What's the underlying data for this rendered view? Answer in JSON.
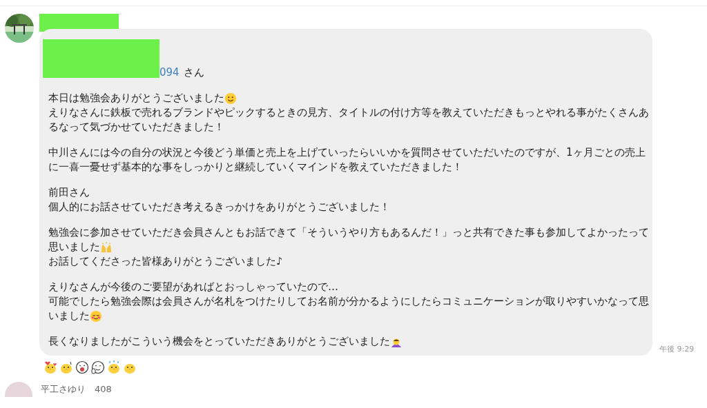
{
  "sender": {
    "name_redacted": true
  },
  "message": {
    "mention_redacted": true,
    "mention": "094",
    "mention_suffix": "さん",
    "paragraphs": [
      [
        {
          "text": "本日は勉強会ありがとうございました",
          "kind": "smile"
        },
        {
          "text": "えりなさんに鉄板で売れるブランドやピックするときの見方、タイトルの付け方等を教えていただきもっとやれる事がたくさんあ"
        },
        {
          "text": "るなって気づかせていただきました！"
        }
      ],
      [
        {
          "text": "中川さんには今の自分の状況と今後どう単価と売上を上げていったらいいかを質問させていただいたのですが、1ヶ月ごとの売上"
        },
        {
          "text": "に一喜一憂せず基本的な事をしっかりと継続していくマインドを教えていただきました！"
        }
      ],
      [
        {
          "text": "前田さん"
        },
        {
          "text": "個人的にお話させていただき考えるきっかけをありがとうございました！"
        }
      ],
      [
        {
          "text": "勉強会に参加させていただき会員さんともお話できて「そういうやり方もあるんだ！」っと共有できた事も参加してよかったって"
        },
        {
          "text": "思いました",
          "kind": "raised-hands"
        },
        {
          "text": "お話してくださった皆様ありがとうございました♪"
        }
      ],
      [
        {
          "text": "えりなさんが今後のご要望があればとおっしゃっていたので…"
        },
        {
          "text": "可能でしたら勉強会際は会員さんが名札をつけたりしてお名前が分かるようにしたらコミュニケーションが取りやすいかなって思"
        },
        {
          "text": "いました",
          "kind": "blush"
        }
      ],
      [
        {
          "text": "長くなりましたがこういう機会をとっていただきありがとうございました",
          "kind": "bow"
        }
      ]
    ],
    "time": "午後 9:29"
  },
  "reactions": [
    {
      "kind": "heart-chick"
    },
    {
      "kind": "waving-chick"
    },
    {
      "kind": "laughing-face"
    },
    {
      "kind": "thumbs-face"
    },
    {
      "kind": "sparkle-chick"
    },
    {
      "kind": "chick"
    }
  ],
  "next_sender": {
    "name": "平工さゆり　408"
  }
}
